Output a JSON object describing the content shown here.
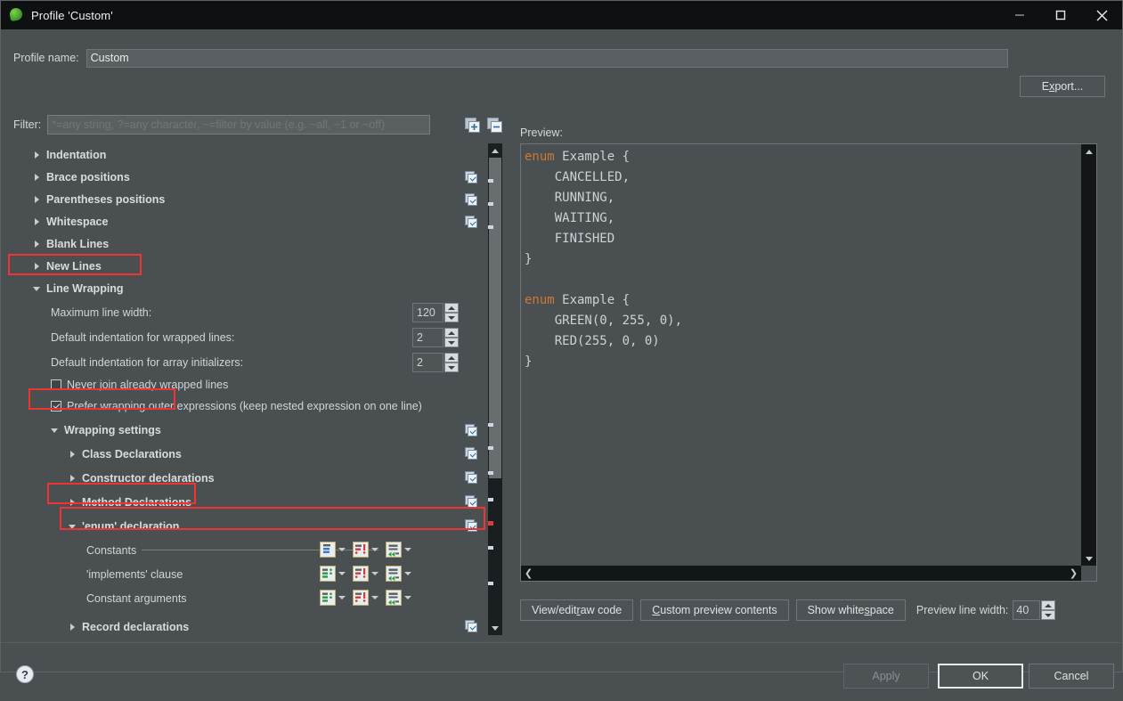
{
  "window": {
    "title": "Profile 'Custom'",
    "icon": "eclipse-leaf-icon",
    "minimize": "minimize-icon",
    "maximize": "maximize-icon",
    "close": "close-icon"
  },
  "profile": {
    "label": "Profile name:",
    "value": "Custom",
    "export_label": "Export..."
  },
  "filter": {
    "label": "Filter:",
    "placeholder": "*=any string, ?=any character, ~=filter by value (e.g. ~all, ~1 or ~off)",
    "value": "",
    "expand_all_icon": "expand-all-icon",
    "collapse_all_icon": "collapse-all-icon"
  },
  "tree": {
    "groups": [
      {
        "label": "Indentation",
        "expanded": false,
        "checkbox": false
      },
      {
        "label": "Brace positions",
        "expanded": false,
        "checkbox": true
      },
      {
        "label": "Parentheses positions",
        "expanded": false,
        "checkbox": true
      },
      {
        "label": "Whitespace",
        "expanded": false,
        "checkbox": true
      },
      {
        "label": "Blank Lines",
        "expanded": false,
        "checkbox": false
      },
      {
        "label": "New Lines",
        "expanded": false,
        "checkbox": false
      },
      {
        "label": "Line Wrapping",
        "expanded": true,
        "checkbox": false
      }
    ],
    "spinners": [
      {
        "label": "Maximum line width:",
        "value": "120"
      },
      {
        "label": "Default indentation for wrapped lines:",
        "value": "2"
      },
      {
        "label": "Default indentation for array initializers:",
        "value": "2"
      }
    ],
    "checkboxes": [
      {
        "label": "Never join already wrapped lines",
        "checked": false
      },
      {
        "label": "Prefer wrapping outer expressions (keep nested expression on one line)",
        "checked": true
      }
    ],
    "wrapping_settings": {
      "label": "Wrapping settings",
      "expanded": true,
      "checkbox": true
    },
    "subgroups": [
      {
        "label": "Class Declarations",
        "expanded": false,
        "checkbox": true
      },
      {
        "label": "Constructor declarations",
        "expanded": false,
        "checkbox": true
      },
      {
        "label": "Method Declarations",
        "expanded": false,
        "checkbox": true
      },
      {
        "label": "'enum' declaration",
        "expanded": true,
        "checkbox": true
      }
    ],
    "wrap_rows": [
      {
        "label": "Constants",
        "icon1": "wrap-where-icon",
        "icon2": "indent-policy-icon",
        "icon3": "force-split-icon"
      },
      {
        "label": "'implements' clause",
        "icon1": "wrap-where-icon",
        "icon2": "indent-policy-icon",
        "icon3": "force-split-icon"
      },
      {
        "label": "Constant arguments",
        "icon1": "wrap-where-icon",
        "icon2": "indent-policy-icon",
        "icon3": "force-split-icon"
      }
    ],
    "trailing_group": {
      "label": "Record declarations",
      "expanded": false,
      "checkbox": true
    }
  },
  "preview": {
    "label": "Preview:",
    "code_line1_kw": "enum",
    "code_rest1": " Example {",
    "code_body1": "    CANCELLED,\n    RUNNING,\n    WAITING,\n    FINISHED\n}\n",
    "code_line2_kw": "enum",
    "code_rest2": " Example {",
    "code_body2": "    GREEN(0, 255, 0),\n    RED(255, 0, 0)\n}",
    "buttons": [
      {
        "pre": "View/edit ",
        "mn": "r",
        "post": "aw code"
      },
      {
        "pre": "",
        "mn": "C",
        "post": "ustom preview contents"
      },
      {
        "pre": "Show white",
        "mn": "s",
        "post": "pace"
      }
    ],
    "line_width_label": "Preview line width:",
    "line_width_value": "40"
  },
  "footer": {
    "help_icon": "help-icon",
    "apply": "Apply",
    "ok": "OK",
    "cancel": "Cancel"
  },
  "colors": {
    "accent_red": "#f03434",
    "keyword": "#cc7832",
    "panel_bg": "#4a4f52",
    "titlebar_bg": "#0f1011"
  }
}
